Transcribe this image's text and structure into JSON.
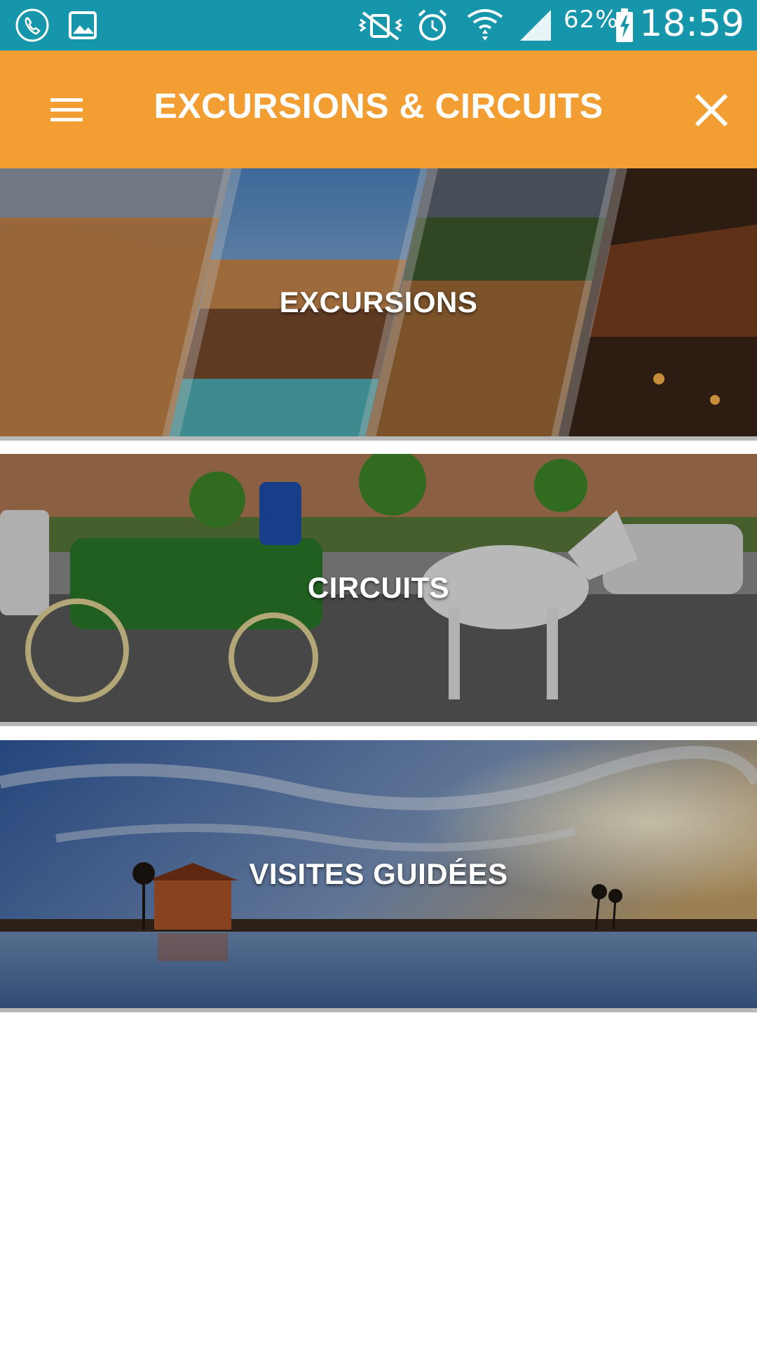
{
  "status_bar": {
    "left_icons": [
      "phone-call-icon",
      "image-icon"
    ],
    "right_icons": [
      "vibrate-mute-icon",
      "alarm-icon",
      "wifi-icon",
      "signal-icon",
      "battery-charging-icon"
    ],
    "battery": "62%",
    "time": "18:59"
  },
  "app_bar": {
    "title": "EXCURSIONS & CIRCUITS",
    "menu_icon": "hamburger-menu-icon",
    "close_icon": "close-icon"
  },
  "categories": [
    {
      "label": "EXCURSIONS"
    },
    {
      "label": "CIRCUITS"
    },
    {
      "label": "VISITES GUIDÉES"
    }
  ],
  "colors": {
    "status_bar": "#1596ab",
    "app_bar": "#f29e33",
    "background": "#ffffff"
  }
}
